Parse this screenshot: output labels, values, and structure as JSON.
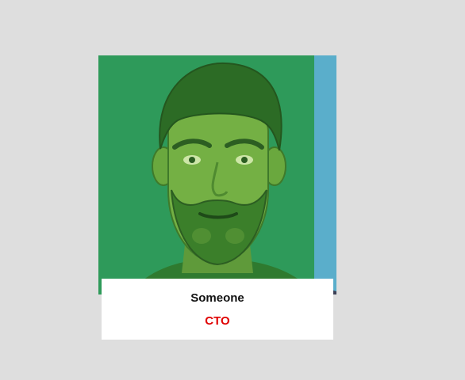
{
  "profile": {
    "name": "Someone",
    "role": "CTO",
    "avatar_icon": "bearded-man-portrait"
  },
  "colors": {
    "page_background": "#dedede",
    "overlay_green": "#2e9a5a",
    "side_strip": "#5aaecb",
    "role_text": "#e00000",
    "name_text": "#111111"
  }
}
